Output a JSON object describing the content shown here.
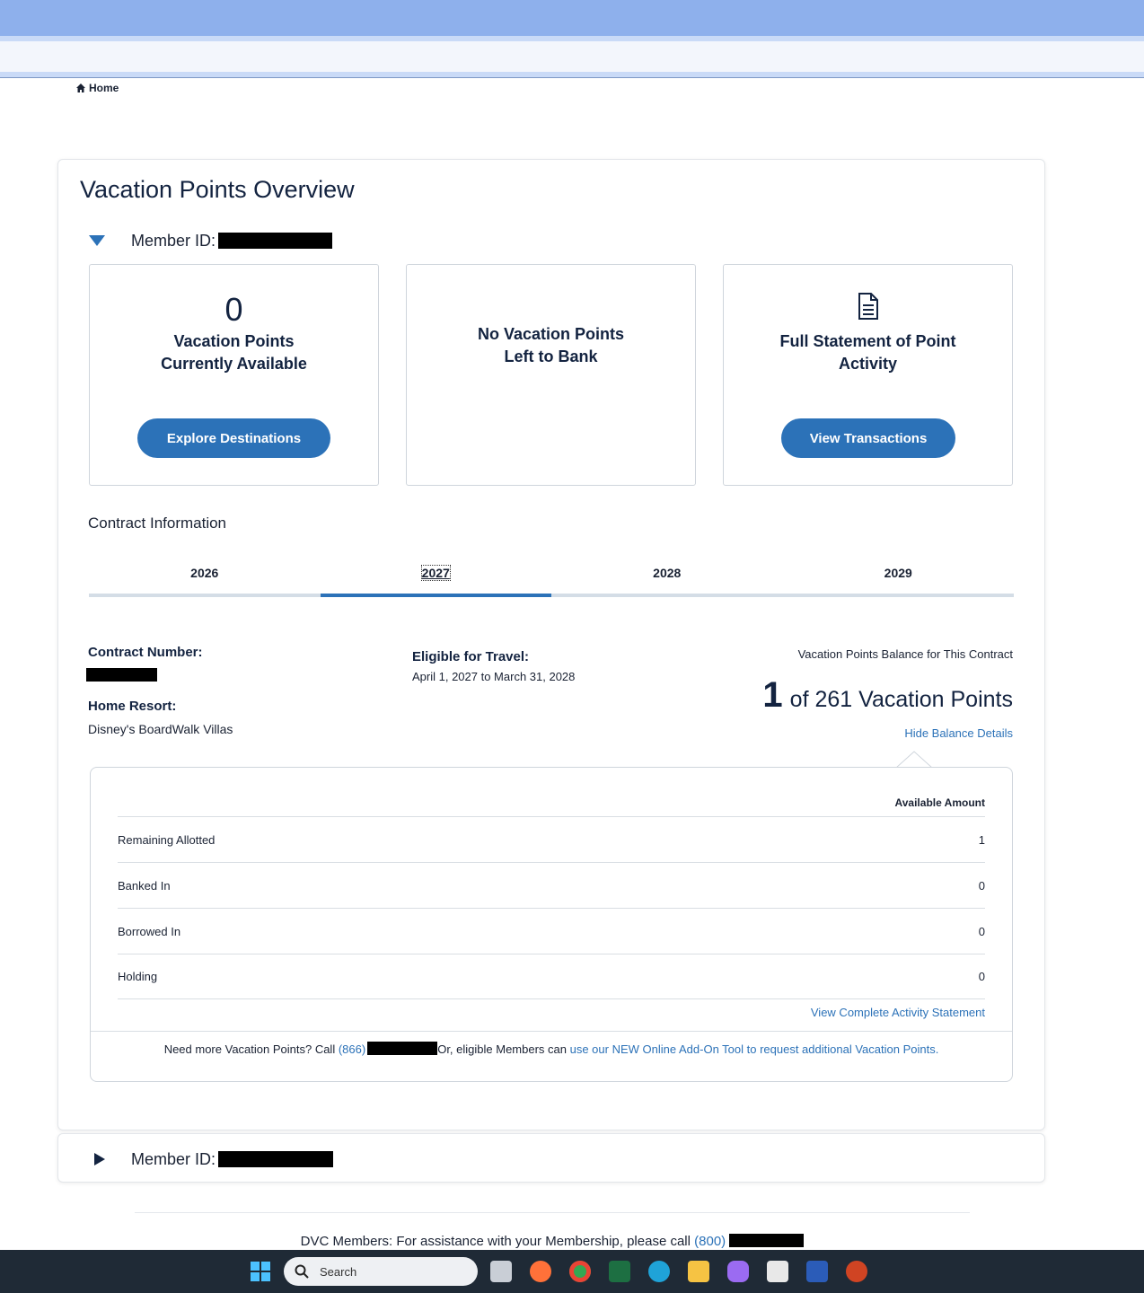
{
  "breadcrumb": {
    "home": "Home"
  },
  "overview": {
    "title": "Vacation Points Overview",
    "member_label": "Member ID:"
  },
  "tiles": {
    "available": {
      "count": "0",
      "line1": "Vacation Points",
      "line2": "Currently Available",
      "button": "Explore Destinations"
    },
    "bank": {
      "line1": "No Vacation Points",
      "line2": "Left to Bank"
    },
    "statement": {
      "line1": "Full Statement of Point",
      "line2": "Activity",
      "button": "View Transactions"
    }
  },
  "contract": {
    "section_title": "Contract Information",
    "tabs": [
      "2026",
      "2027",
      "2028",
      "2029"
    ],
    "active_tab": "2027",
    "number_label": "Contract Number:",
    "home_resort_label": "Home Resort:",
    "home_resort": "Disney's BoardWalk Villas",
    "eligible_label": "Eligible for Travel:",
    "eligible_dates": "April 1, 2027 to March 31, 2028",
    "balance_heading": "Vacation Points Balance for This Contract",
    "balance_current": "1",
    "balance_rest": "of 261 Vacation Points",
    "hide_details": "Hide Balance Details"
  },
  "details": {
    "column_header": "Available Amount",
    "rows": [
      {
        "label": "Remaining Allotted",
        "value": "1"
      },
      {
        "label": "Banked In",
        "value": "0"
      },
      {
        "label": "Borrowed In",
        "value": "0"
      },
      {
        "label": "Holding",
        "value": "0"
      }
    ],
    "view_statement": "View Complete Activity Statement",
    "footer_prefix": "Need more Vacation Points? Call",
    "footer_phone": "(866)",
    "footer_mid": "Or, eligible Members can",
    "footer_link": "use our NEW Online Add-On Tool to request additional Vacation Points."
  },
  "member2": {
    "label": "Member ID:"
  },
  "footer": {
    "text": "DVC Members: For assistance with your Membership, please call",
    "phone": "(800)"
  },
  "taskbar": {
    "search_placeholder": "Search",
    "apps": [
      "windows-start",
      "task-view",
      "firefox",
      "chrome",
      "excel",
      "edge",
      "file-explorer",
      "copilot",
      "store",
      "word",
      "powerpoint"
    ]
  },
  "colors": {
    "primary": "#2c72b8",
    "header": "#8eb0ec",
    "taskbar": "#1f2a36"
  }
}
